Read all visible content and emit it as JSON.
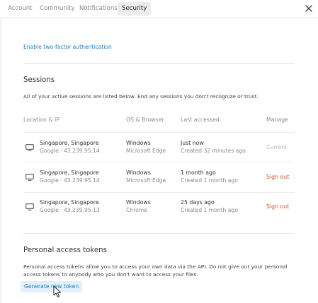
{
  "tabs": [
    {
      "label": "Account"
    },
    {
      "label": "Community"
    },
    {
      "label": "Notifications"
    },
    {
      "label": "Security",
      "active": true
    }
  ],
  "close_icon": "close-icon",
  "two_factor": {
    "link_label": "Enable two-factor authentication"
  },
  "sessions": {
    "title": "Sessions",
    "description": "All of your active sessions are listed below. End any sessions you don't recognize or trust.",
    "columns": {
      "location": "Location & IP",
      "os_browser": "OS & Browser",
      "last_accessed": "Last accessed",
      "manage": "Manage"
    },
    "rows": [
      {
        "icon": "monitor-icon",
        "location": "Singapore, Singapore",
        "ip": "Google · 43.239.95.14",
        "os": "Windows",
        "browser": "Microsoft Edge",
        "last_accessed": "Just now",
        "created": "Created 32 minutes ago",
        "manage": "Current"
      },
      {
        "icon": "monitor-icon",
        "location": "Singapore, Singapore",
        "ip": "Google · 43.239.95.14",
        "os": "Windows",
        "browser": "Microsoft Edge",
        "last_accessed": "1 month ago",
        "created": "Created 1 month ago",
        "manage": "Sign out"
      },
      {
        "icon": "monitor-icon",
        "location": "Singapore, Singapore",
        "ip": "Google · 43.239.95.13",
        "os": "Windows",
        "browser": "Chrome",
        "last_accessed": "25 days ago",
        "created": "Created 1 month ago",
        "manage": "Sign out"
      }
    ]
  },
  "tokens": {
    "title": "Personal access tokens",
    "description_line1": "Personal access tokens allow you to access your own data via the API. Do not give out your personal",
    "description_line2": "access tokens to anybody who you don't want to access your files.",
    "generate_label": "Generate new token"
  },
  "colors": {
    "link": "#1d7fc2",
    "sign_out": "#c8502a",
    "current": "#b8b8b8",
    "active_tab_bg": "#ececec",
    "button_bg": "#e3f0fb"
  }
}
